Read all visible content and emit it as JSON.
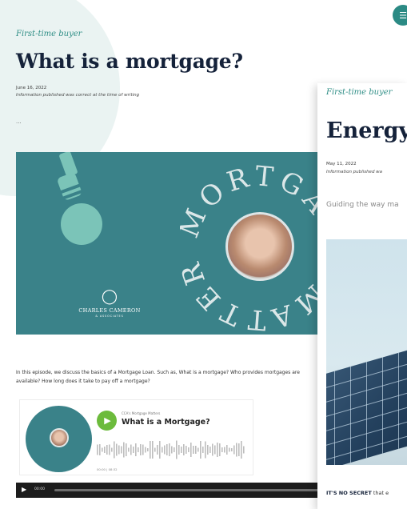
{
  "back_article": {
    "category": "First-time buyer",
    "title": "What is a mortgage?",
    "date": "June 16, 2022",
    "note": "Information published was correct at the time of writing",
    "ellipsis": "...",
    "podcast_art": {
      "ring_text": "MORTGAGE MATTERS",
      "brand_name": "CHARLES CAMERON",
      "brand_sub": "& ASSOCIATES"
    },
    "description": "In this episode, we discuss the basics of a Mortgage Loan. Such as, What is a mortgage? Who provides mortgages are available? How long does it take to pay off a mortgage?",
    "player": {
      "show_name": "CCA's Mortgage Matters",
      "episode_title": "What is a Mortgage?",
      "time": "00:00 | 08:32"
    },
    "audio": {
      "time": "00:00"
    }
  },
  "front_article": {
    "category": "First-time buyer",
    "title": "Energy",
    "date": "May 11, 2022",
    "note": "Information published wa",
    "lead": "Guiding the way ma",
    "body_bold": "IT'S NO SECRET",
    "body_rest": " that e"
  },
  "colors": {
    "teal": "#3a8289",
    "navy": "#15223a",
    "green_play": "#6cbb3c"
  },
  "icons": {
    "menu": "menu-icon",
    "play": "play-icon",
    "microphone": "microphone-icon"
  }
}
